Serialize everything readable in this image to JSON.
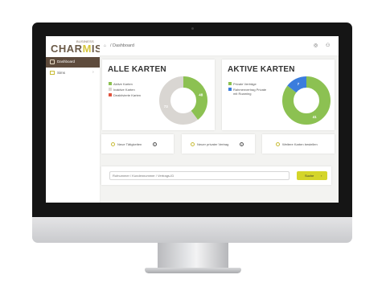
{
  "brand": {
    "name_pre": "CHAR",
    "name_accent": "M",
    "name_post": "IS",
    "sub": "BUSINESS"
  },
  "sidebar": {
    "items": [
      {
        "label": "Dashboard",
        "active": true
      },
      {
        "label": "Sims",
        "active": false
      }
    ]
  },
  "topbar": {
    "breadcrumb": "/ Dashboard"
  },
  "cards": {
    "alle": {
      "title": "ALLE KARTEN",
      "legend": [
        "Aktive Karten",
        "Inaktive Karten",
        "Deaktivierte Karten"
      ],
      "legend_colors": [
        "#8cc152",
        "#d9d6d2",
        "#e0533d"
      ],
      "values": [
        48,
        73,
        0
      ],
      "labels": [
        "48",
        "73"
      ]
    },
    "aktive": {
      "title": "AKTIVE KARTEN",
      "legend": [
        "Private Verträge",
        "Rahmenvertrag Private",
        "mit Roaming"
      ],
      "legend_colors": [
        "#8cc152",
        "#3b7ddd"
      ],
      "values": [
        41,
        7
      ],
      "labels": [
        "41",
        "7"
      ]
    }
  },
  "actions": [
    {
      "label": "Neue Tätigkeiten",
      "info": true
    },
    {
      "label": "Neuer privater Vertrag",
      "info": true
    },
    {
      "label": "Weitere Karten bestellen",
      "info": false
    }
  ],
  "search": {
    "placeholder": "Rufnummer / Kundennummer / Vertrags-ID",
    "button_label": "Suche"
  },
  "colors": {
    "accent": "#d4d52a",
    "sidebar_active": "#5e4b3c",
    "green": "#8cc152",
    "blue": "#3b7ddd",
    "grey": "#d9d6d2"
  }
}
